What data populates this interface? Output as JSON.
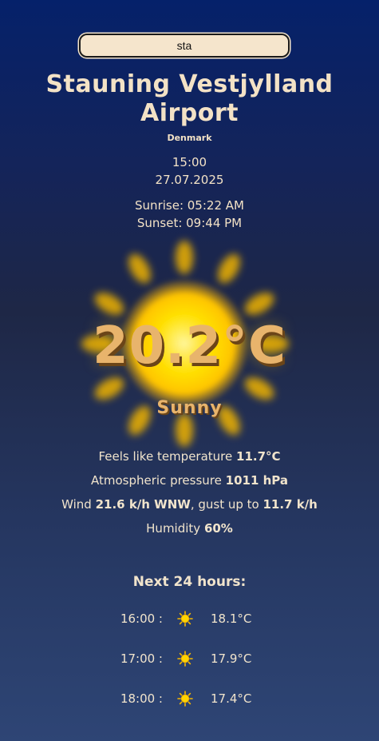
{
  "search": {
    "value": "sta"
  },
  "location": {
    "name": "Stauning Vestjylland Airport",
    "country": "Denmark"
  },
  "datetime": {
    "time": "15:00",
    "date": "27.07.2025"
  },
  "sun": {
    "sunrise": "Sunrise: 05:22 AM",
    "sunset": "Sunset: 09:44 PM"
  },
  "current": {
    "temperature": "20.2°C",
    "condition": "Sunny",
    "condition_icon": "sun-icon",
    "feels_like_label": "Feels like temperature ",
    "feels_like_value": "11.7°C",
    "pressure_label": "Atmospheric pressure ",
    "pressure_value": "1011 hPa",
    "wind_label": "Wind ",
    "wind_value": "21.6 k/h WNW",
    "gust_label": ", gust up to ",
    "gust_value": "11.7 k/h",
    "humidity_label": "Humidity ",
    "humidity_value": "60%"
  },
  "forecast": {
    "title": "Next 24 hours:",
    "hours": [
      {
        "time": "16:00 :",
        "icon": "sun-icon",
        "temp": "18.1°C"
      },
      {
        "time": "17:00 :",
        "icon": "sun-icon",
        "temp": "17.9°C"
      },
      {
        "time": "18:00 :",
        "icon": "sun-icon",
        "temp": "17.4°C"
      }
    ]
  },
  "colors": {
    "accent": "#e8b46c",
    "text": "#f1e4cc",
    "sun": "#ffd400"
  }
}
